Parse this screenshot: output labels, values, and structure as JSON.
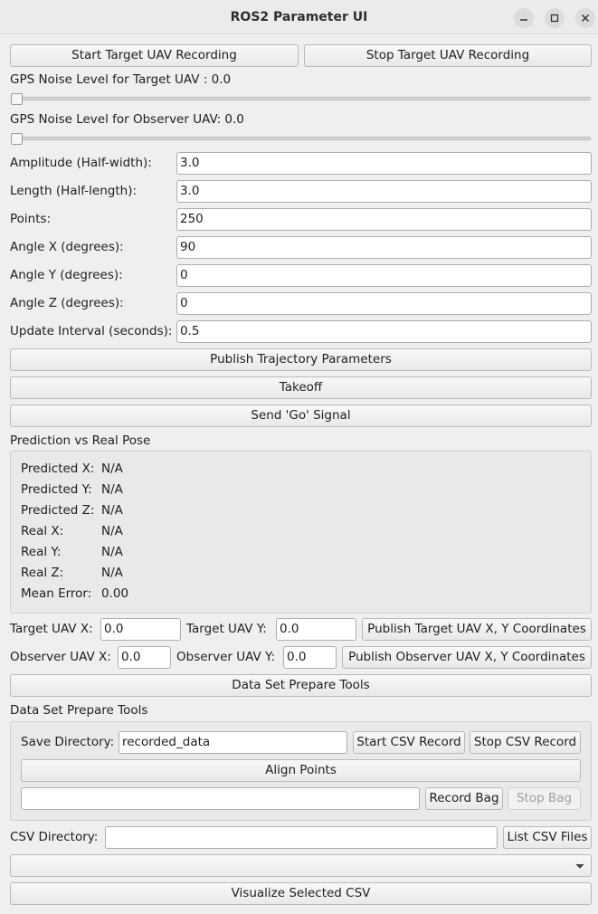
{
  "window": {
    "title": "ROS2 Parameter UI"
  },
  "recording": {
    "start_label": "Start Target UAV Recording",
    "stop_label": "Stop Target UAV Recording"
  },
  "noise": {
    "target_label": "GPS Noise Level for Target UAV : 0.0",
    "target_value": 0.0,
    "observer_label": "GPS Noise Level for Observer UAV: 0.0",
    "observer_value": 0.0
  },
  "params": [
    {
      "label": "Amplitude (Half-width):",
      "value": "3.0"
    },
    {
      "label": "Length (Half-length):",
      "value": "3.0"
    },
    {
      "label": "Points:",
      "value": "250"
    },
    {
      "label": "Angle X (degrees):",
      "value": "90"
    },
    {
      "label": "Angle Y (degrees):",
      "value": "0"
    },
    {
      "label": "Angle Z (degrees):",
      "value": "0"
    },
    {
      "label": "Update Interval (seconds):",
      "value": "0.5"
    }
  ],
  "actions": {
    "publish_label": "Publish Trajectory Parameters",
    "takeoff_label": "Takeoff",
    "go_label": "Send 'Go' Signal"
  },
  "prediction": {
    "title": "Prediction vs Real Pose",
    "rows": [
      {
        "label": "Predicted X:",
        "value": "N/A"
      },
      {
        "label": "Predicted Y:",
        "value": "N/A"
      },
      {
        "label": "Predicted Z:",
        "value": "N/A"
      },
      {
        "label": "Real X:",
        "value": "N/A"
      },
      {
        "label": "Real Y:",
        "value": "N/A"
      },
      {
        "label": "Real Z:",
        "value": "N/A"
      },
      {
        "label": "Mean Error:",
        "value": "0.00"
      }
    ]
  },
  "target_coords": {
    "x_label": "Target UAV X:",
    "x_value": "0.0",
    "y_label": "Target UAV Y:",
    "y_value": "0.0",
    "publish_label": "Publish Target UAV X, Y Coordinates"
  },
  "observer_coords": {
    "x_label": "Observer UAV X:",
    "x_value": "0.0",
    "y_label": "Observer UAV Y:",
    "y_value": "0.0",
    "publish_label": "Publish Observer UAV  X, Y Coordinates"
  },
  "dataset": {
    "toggle_label": "Data Set Prepare Tools",
    "group_title": "Data Set Prepare Tools",
    "save_dir_label": "Save Directory:",
    "save_dir_value": "recorded_data",
    "start_csv_label": "Start CSV Record",
    "stop_csv_label": "Stop CSV Record",
    "align_label": "Align Points",
    "bag_value": "",
    "record_bag_label": "Record Bag",
    "stop_bag_label": "Stop Bag"
  },
  "csv": {
    "dir_label": "CSV Directory:",
    "dir_value": "",
    "list_label": "List CSV Files",
    "selected": "",
    "visualize_label": "Visualize Selected CSV"
  }
}
